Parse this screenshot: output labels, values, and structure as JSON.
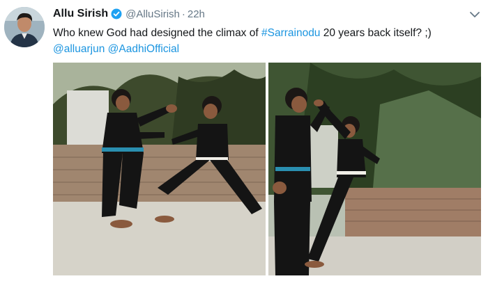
{
  "tweet": {
    "author_name": "Allu Sirish",
    "author_handle": "@AlluSirish",
    "separator": "·",
    "timestamp": "22h",
    "text_before": "Who knew God had designed the climax of ",
    "hashtag": "#Sarrainodu",
    "text_after": " 20 years back itself? ;)",
    "mention_1": "@alluarjun",
    "mention_2": "@AadhiOfficial",
    "link_color": "#1b95e0",
    "verified_color": "#1da1f2"
  }
}
